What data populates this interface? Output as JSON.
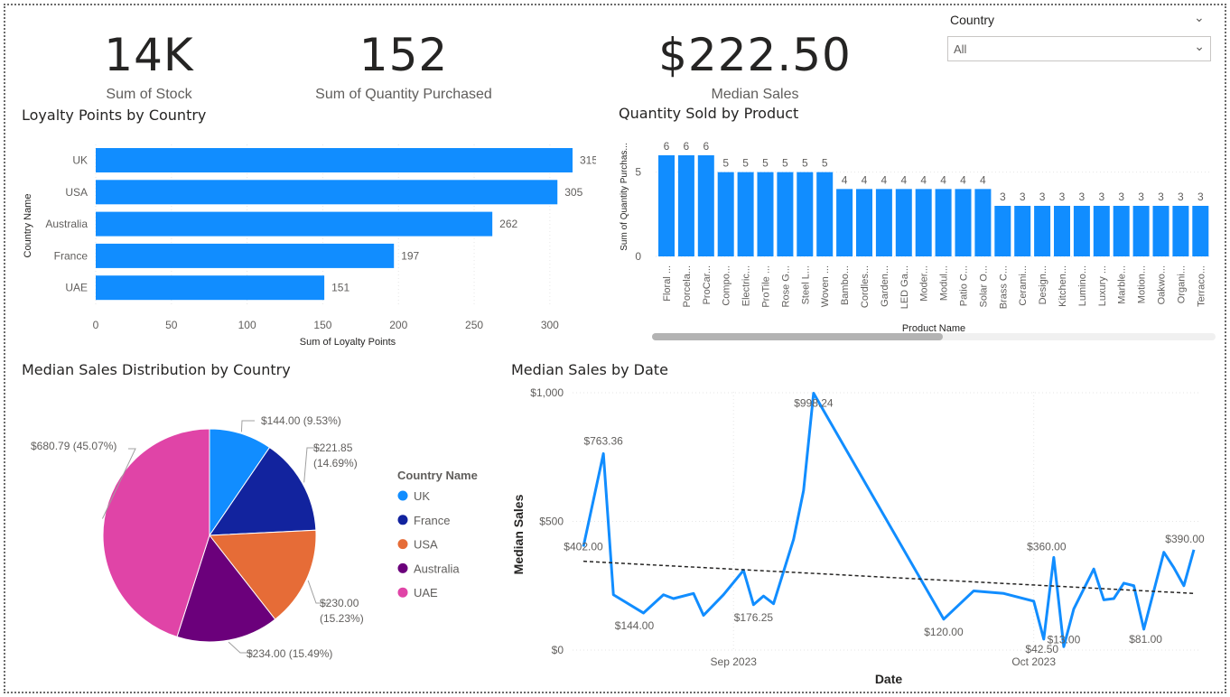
{
  "kpis": [
    {
      "value": "14K",
      "label": "Sum of  Stock"
    },
    {
      "value": "152",
      "label": "Sum of Quantity Purchased"
    },
    {
      "value": "$222.50",
      "label": "Median Sales"
    }
  ],
  "slicer": {
    "label": "Country",
    "value": "All",
    "collapse_icon": "chevron-down-icon",
    "dropdown_icon": "chevron-down-icon"
  },
  "titles": {
    "loyalty": "Loyalty Points by Country",
    "quantity": "Quantity Sold by Product",
    "pie": "Median Sales Distribution by Country",
    "line": "Median Sales by Date"
  },
  "chart_data": [
    {
      "type": "bar",
      "orientation": "horizontal",
      "title": "Loyalty Points by Country",
      "categories": [
        "UK",
        "USA",
        "Australia",
        "France",
        "UAE"
      ],
      "values": [
        315,
        305,
        262,
        197,
        151
      ],
      "xlabel": "Sum of Loyalty Points",
      "ylabel": "Country Name",
      "xticks": [
        0,
        50,
        100,
        150,
        200,
        250,
        300
      ],
      "xlim": [
        0,
        315
      ],
      "color": "#118DFF"
    },
    {
      "type": "bar",
      "title": "Quantity Sold by Product",
      "categories": [
        "Floral ...",
        "Porcela...",
        "ProCar...",
        "Compo...",
        "Electric...",
        "ProTile ...",
        "Rose G...",
        "Steel L...",
        "Woven ...",
        "Bambo...",
        "Cordles...",
        "Garden...",
        "LED Ga...",
        "Moder...",
        "Modul...",
        "Patio C...",
        "Solar O...",
        "Brass C...",
        "Cerami...",
        "Design...",
        "Kitchen...",
        "Lumino...",
        "Luxury ...",
        "Marble...",
        "Motion...",
        "Oakwo...",
        "Organi...",
        "Terraco..."
      ],
      "values": [
        6,
        6,
        6,
        5,
        5,
        5,
        5,
        5,
        5,
        4,
        4,
        4,
        4,
        4,
        4,
        4,
        4,
        3,
        3,
        3,
        3,
        3,
        3,
        3,
        3,
        3,
        3,
        3
      ],
      "xlabel": "Product Name",
      "ylabel": "Sum of Quantity Purchas...",
      "yticks": [
        0,
        5
      ],
      "ylim": [
        0,
        6
      ],
      "color": "#118DFF"
    },
    {
      "type": "pie",
      "title": "Median Sales Distribution by Country",
      "legend_title": "Country Name",
      "legend_position": "right",
      "slices": [
        {
          "name": "UK",
          "value": 144.0,
          "label": "$144.00 (9.53%)",
          "color": "#118DFF"
        },
        {
          "name": "France",
          "value": 221.85,
          "label": "$221.85 (14.69%)",
          "color": "#12239E"
        },
        {
          "name": "USA",
          "value": 230.0,
          "label": "$230.00 (15.23%)",
          "color": "#E66C37"
        },
        {
          "name": "Australia",
          "value": 234.0,
          "label": "$234.00 (15.49%)",
          "color": "#6B007B"
        },
        {
          "name": "UAE",
          "value": 680.79,
          "label": "$680.79 (45.07%)",
          "color": "#E044A7"
        }
      ]
    },
    {
      "type": "line",
      "title": "Median Sales by Date",
      "xlabel": "Date",
      "ylabel": "Median Sales",
      "xticks": [
        "Sep 2023",
        "Oct 2023"
      ],
      "yticks": [
        "$0",
        "$500",
        "$1,000"
      ],
      "ylim": [
        0,
        1000
      ],
      "trendline": true,
      "color": "#118DFF",
      "series": [
        {
          "x": [
            "2023-08-17",
            "2023-08-19",
            "2023-08-20",
            "2023-08-23",
            "2023-08-25",
            "2023-08-26",
            "2023-08-28",
            "2023-08-29",
            "2023-08-31",
            "2023-09-02",
            "2023-09-03",
            "2023-09-04",
            "2023-09-05",
            "2023-09-07",
            "2023-09-08",
            "2023-09-09",
            "2023-09-22",
            "2023-09-25",
            "2023-09-28",
            "2023-10-01",
            "2023-10-02",
            "2023-10-03",
            "2023-10-04",
            "2023-10-05",
            "2023-10-07",
            "2023-10-08",
            "2023-10-09",
            "2023-10-10",
            "2023-10-11",
            "2023-10-12",
            "2023-10-14",
            "2023-10-15",
            "2023-10-16",
            "2023-10-17"
          ],
          "values": [
            402.0,
            763.36,
            215,
            144.0,
            215,
            200,
            220,
            135,
            215,
            310,
            176.25,
            210,
            180,
            430,
            620,
            998.24,
            120.0,
            230,
            220,
            190,
            42.5,
            360.0,
            13.0,
            160,
            315,
            195,
            200,
            260,
            250,
            81.0,
            380,
            320,
            250,
            390.0
          ],
          "point_labels": [
            "$402.00",
            "$763.36",
            "",
            "$144.00",
            "",
            "",
            "",
            "",
            "",
            "",
            "$176.25",
            "",
            "",
            "",
            "",
            "$998.24",
            "$120.00",
            "",
            "",
            "",
            "$42.50",
            "$360.00",
            "$13.00",
            "",
            "",
            "",
            "",
            "",
            "",
            "$81.00",
            "",
            "",
            "",
            "$390.00"
          ]
        }
      ],
      "trend": {
        "start": 345,
        "end": 220
      }
    }
  ]
}
